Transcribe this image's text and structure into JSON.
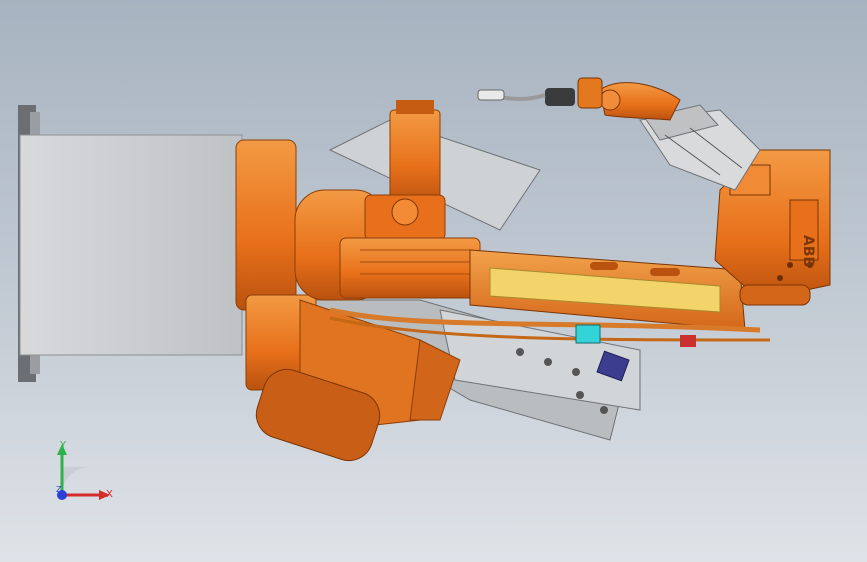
{
  "viewport": {
    "background_top": "#a7b3c0",
    "background_bottom": "#dfe3e8"
  },
  "model": {
    "brand_logo_text": "ABB",
    "colors": {
      "robot_orange": "#e8701a",
      "robot_orange_dark": "#b9520f",
      "frame_gray": "#c8cccf",
      "cable_yellow": "#f3d46a",
      "accent_cyan": "#33d4d8",
      "accent_navy": "#3b3d8f"
    }
  },
  "triad": {
    "x_label": "X",
    "y_label": "Y",
    "z_label": "Z",
    "x_color": "#d62b2b",
    "y_color": "#2db34a",
    "z_color": "#2a3fd6"
  }
}
